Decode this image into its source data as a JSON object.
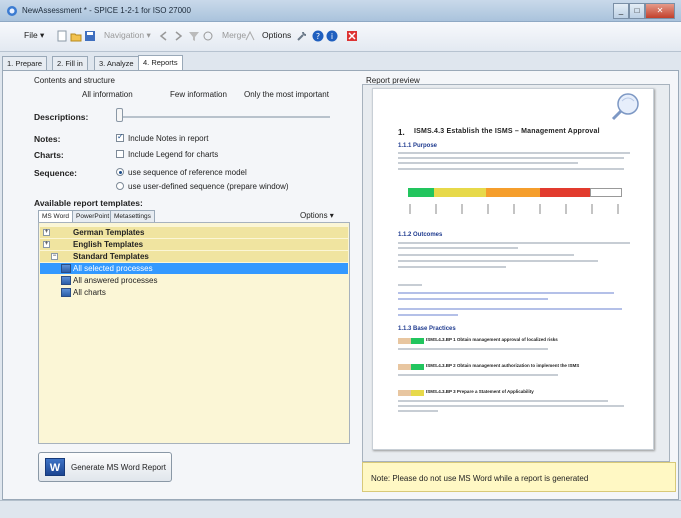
{
  "window": {
    "title": "NewAssessment * - SPICE 1-2-1 for ISO 27000",
    "min_glyph": "_",
    "max_glyph": "□",
    "close_glyph": "✕"
  },
  "toolbar": {
    "file": "File ▾",
    "navigation": "Navigation ▾",
    "merge": "Merge",
    "options": "Options"
  },
  "tabs": [
    "1. Prepare",
    "2. Fill in",
    "3. Analyze",
    "4. Reports"
  ],
  "left": {
    "contents_label": "Contents and structure",
    "levels": [
      "All information",
      "Few information",
      "Only the most important"
    ],
    "descriptions_label": "Descriptions:",
    "notes_label": "Notes:",
    "notes_option": "Include Notes in report",
    "charts_label": "Charts:",
    "charts_option": "Include Legend for charts",
    "sequence_label": "Sequence:",
    "sequence_options": [
      "use sequence of reference model",
      "use user-defined sequence (prepare window)"
    ],
    "templates_label": "Available report templates:",
    "subtabs": [
      "MS Word",
      "PowerPoint",
      "Metasettings"
    ],
    "options_menu": "Options ▾",
    "tree": [
      {
        "label": "German Templates",
        "kind": "group"
      },
      {
        "label": "English Templates",
        "kind": "group"
      },
      {
        "label": "Standard Templates",
        "kind": "group"
      },
      {
        "label": "All selected processes",
        "kind": "selected"
      },
      {
        "label": "All answered processes",
        "kind": "item"
      },
      {
        "label": "All charts",
        "kind": "item"
      }
    ],
    "generate_button": "Generate MS Word Report",
    "generate_icon_letter": "W"
  },
  "preview": {
    "label": "Report preview",
    "heading_num": "1.",
    "heading": "ISMS.4.3 Establish the ISMS – Management Approval",
    "s1": "1.1.1 Purpose",
    "s2": "1.1.2 Outcomes",
    "s3": "1.1.3 Base Practices",
    "bp": [
      "ISMS.4.3.BP 1 Obtain management approval of localized risks",
      "ISMS.4.3.BP 2 Obtain management authorization to implement the ISMS",
      "ISMS.4.3.BP 3 Prepare a Statement of Applicability"
    ],
    "bar_colors": [
      "#22c55e",
      "#e7d94a",
      "#f59e2c",
      "#e23b2e",
      "#ffffff"
    ]
  },
  "note": "Note: Please do not use MS Word while a report is generated"
}
